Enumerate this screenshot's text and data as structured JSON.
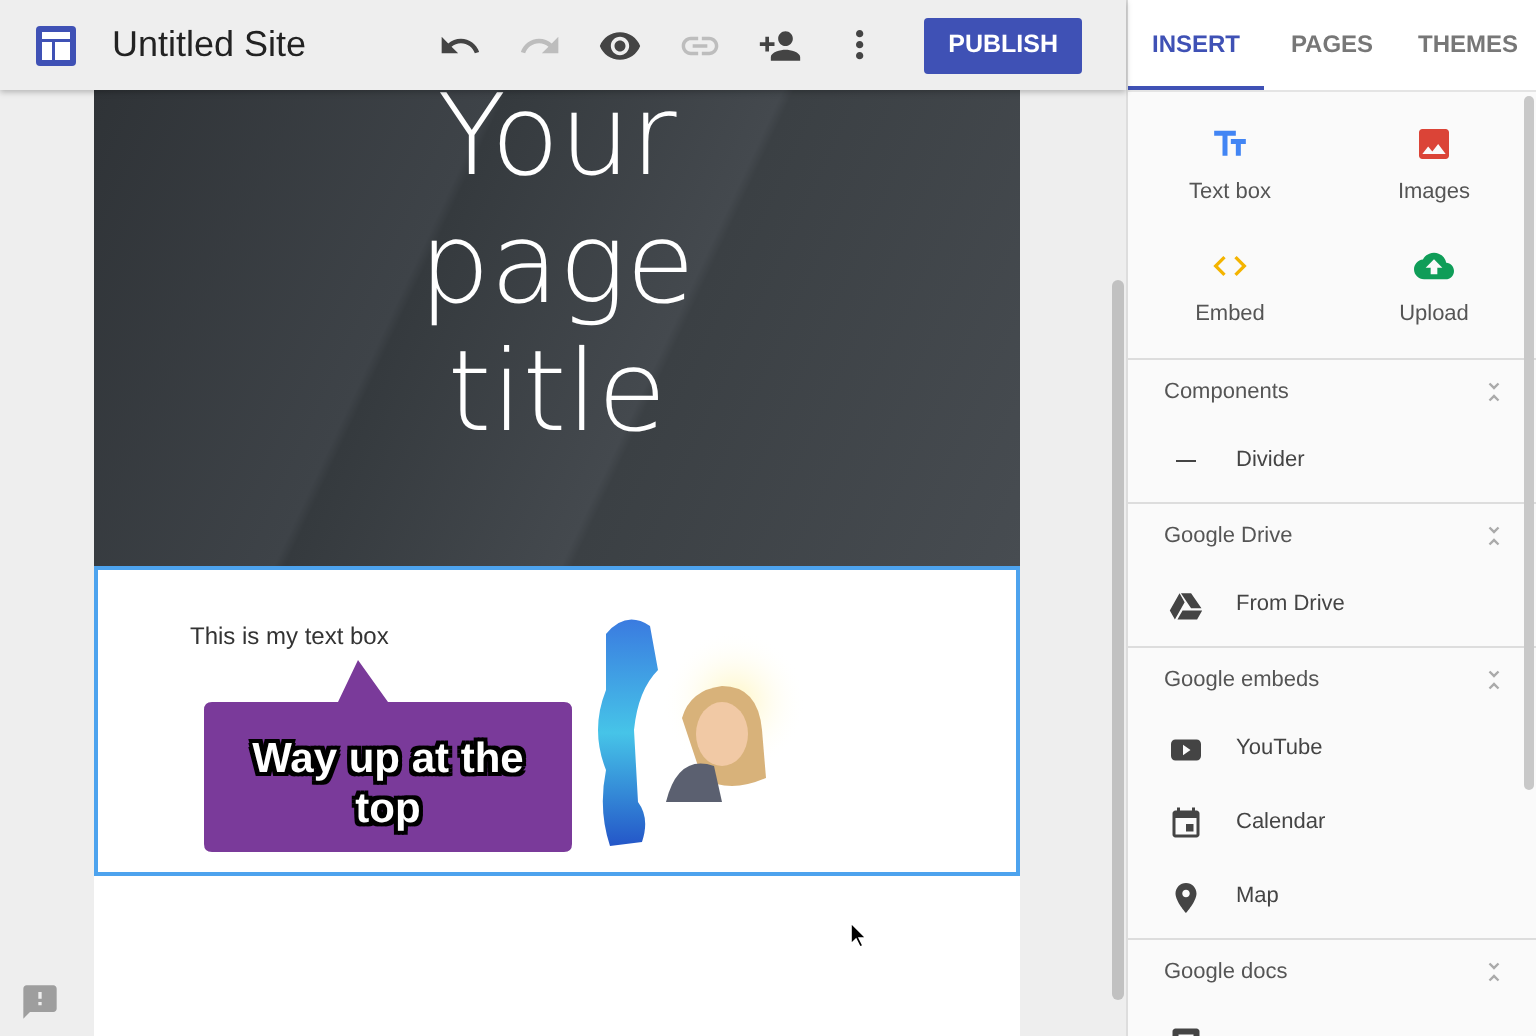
{
  "app": {
    "title": "Untitled Site"
  },
  "toolbar": [
    {
      "kind": "undo",
      "disabled": false
    },
    {
      "kind": "redo",
      "disabled": true
    },
    {
      "kind": "preview",
      "disabled": false
    },
    {
      "kind": "link",
      "disabled": true
    },
    {
      "kind": "share",
      "disabled": false
    },
    {
      "kind": "more",
      "disabled": false
    }
  ],
  "publish_button": "PUBLISH",
  "page": {
    "title": "Your page title",
    "text_box": "This is my text box",
    "callout": "Way up at the top"
  },
  "tabs": [
    {
      "label": "INSERT",
      "selected": true
    },
    {
      "label": "PAGES",
      "selected": false
    },
    {
      "label": "THEMES",
      "selected": false
    }
  ],
  "insert_items": [
    {
      "kind": "text",
      "label": "Text box"
    },
    {
      "kind": "images",
      "label": "Images"
    },
    {
      "kind": "embed",
      "label": "Embed"
    },
    {
      "kind": "upload",
      "label": "Upload"
    }
  ],
  "sections": [
    {
      "title": "Components",
      "expanded": true,
      "items": [
        {
          "kind": "divider",
          "label": "Divider"
        }
      ]
    },
    {
      "title": "Google Drive",
      "expanded": true,
      "items": [
        {
          "kind": "drive",
          "label": "From Drive"
        }
      ]
    },
    {
      "title": "Google embeds",
      "expanded": true,
      "items": [
        {
          "kind": "youtube",
          "label": "YouTube"
        },
        {
          "kind": "calendar",
          "label": "Calendar"
        },
        {
          "kind": "map",
          "label": "Map"
        }
      ]
    },
    {
      "title": "Google docs",
      "expanded": true,
      "items": [
        {
          "kind": "docs"
        }
      ]
    }
  ]
}
